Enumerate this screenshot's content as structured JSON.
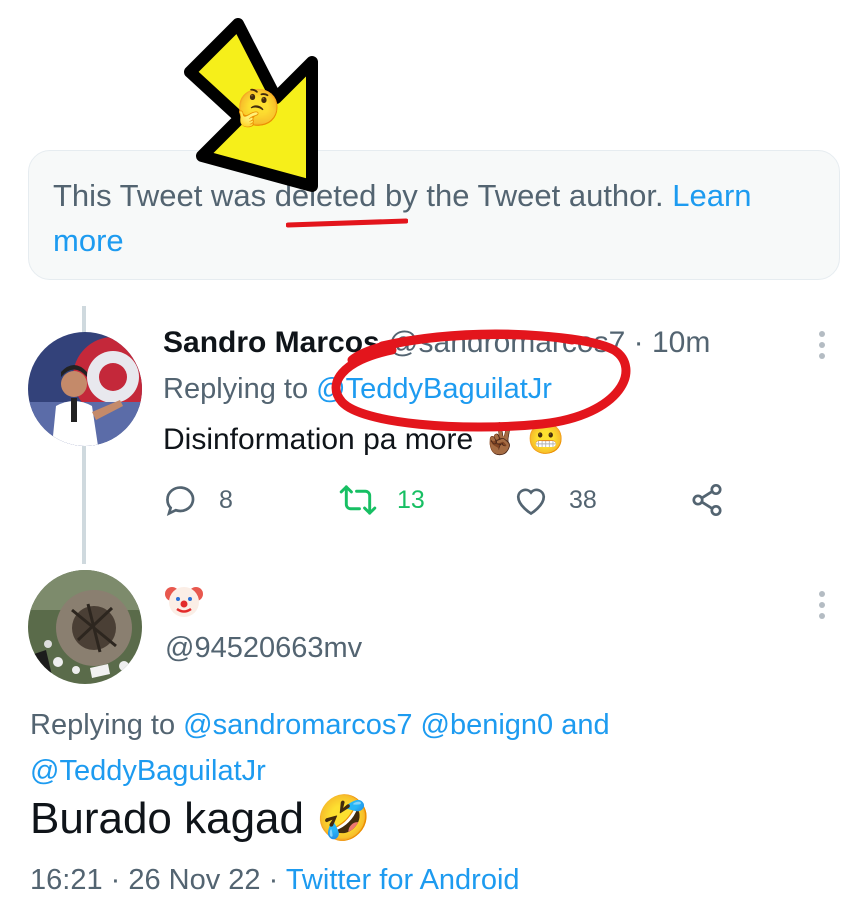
{
  "notice": {
    "text_before": "This Tweet was ",
    "highlighted_word": "deleted",
    "text_after": " by the Tweet author. ",
    "link": "Learn more"
  },
  "reply_tweet": {
    "display_name": "Sandro Marcos",
    "handle": "@sandromarcos7",
    "separator": " · ",
    "time": "10m",
    "replying_prefix": "Replying to ",
    "replying_to": "@TeddyBaguilatJr",
    "text": "Disinformation pa more ",
    "emoji_1": "✌🏾",
    "emoji_2": "😬",
    "replies": "8",
    "retweets": "13",
    "likes": "38"
  },
  "main_tweet": {
    "display_name_emoji": "🤡",
    "handle": "@94520663mv",
    "replying_prefix": "Replying to ",
    "mention_1": "@sandromarcos7",
    "mention_2": "@benign0",
    "conjunction": " and",
    "mention_3": "@TeddyBaguilatJr",
    "text": "Burado kagad ",
    "text_emoji": "🤣",
    "time": "16:21",
    "date": "26 Nov 22",
    "dot": " · ",
    "source": "Twitter for Android"
  },
  "overlay": {
    "arrow_emoji": "🤔",
    "arrow_color": "#f6ef1a",
    "annotation_color": "#e3151c"
  },
  "colors": {
    "link": "#1d9bf0",
    "retweet_green": "#17bf63",
    "muted": "#536471"
  }
}
